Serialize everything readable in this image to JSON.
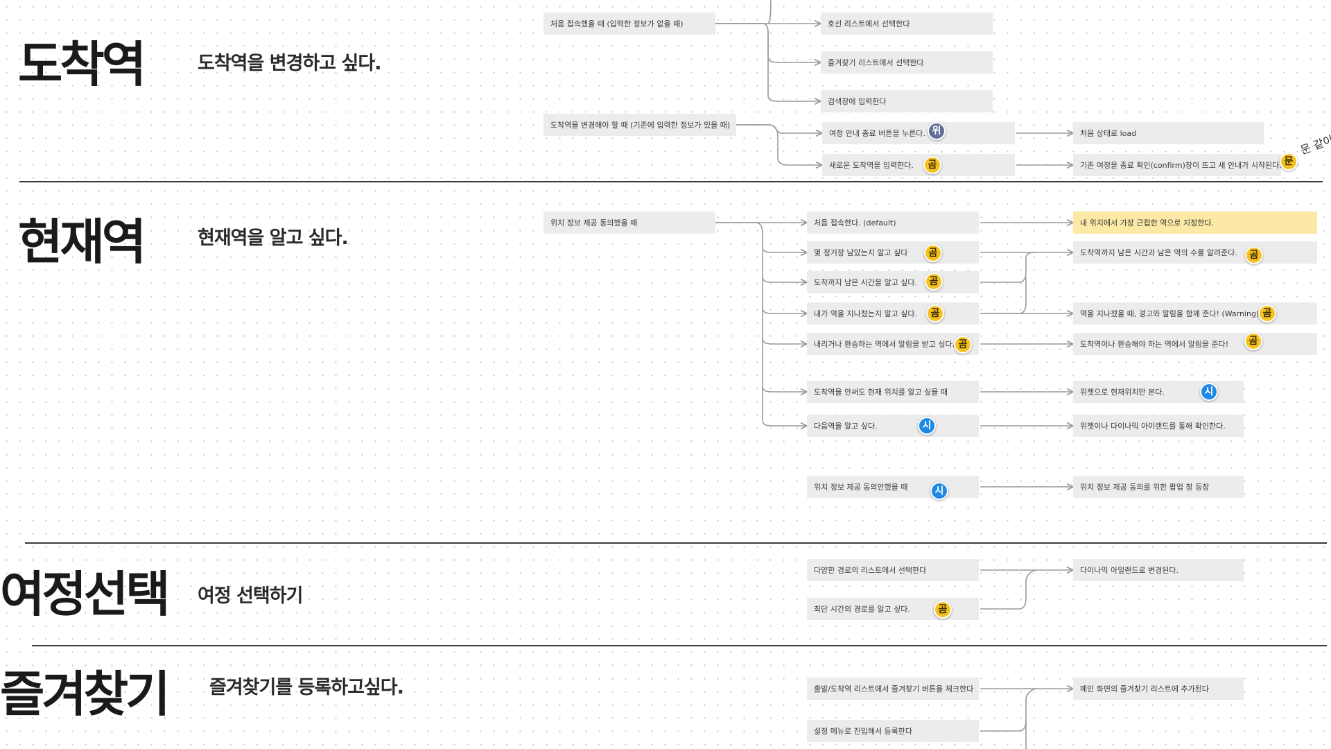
{
  "colors": {
    "badge_yellow": "#f6c221",
    "badge_blue": "#1e88e5",
    "badge_slate": "#5f6f94",
    "node_bg": "#ececec",
    "node_highlight": "#fbe9a5",
    "connector": "#9a9a9a",
    "divider": "#3a3a3a"
  },
  "sections": {
    "arrival": {
      "title": "도착역",
      "subtitle": "도착역을 변경하고 싶다.",
      "nodes": {
        "first_access": "처음 접속했을 때 (입력한 정보가 없을 때)",
        "line_list": "호선 리스트에서 선택한다",
        "favorites_list": "즐겨찾기 리스트에서 선택한다",
        "search_input": "검색창에 입력한다",
        "change_needed": "도착역을 변경해야 할 때 (기존에 입력한 정보가 있을 때)",
        "end_guide_button": "여정 안내 종료 버튼을 누른다.",
        "new_station_input": "새로운 도착역을 입력한다.",
        "initial_load": "처음 상태로 load",
        "confirm_new_guide": "기존 여정을 종료 확인(confirm)창이 뜨고 새 안내가 시작된다."
      },
      "badges": {
        "end_guide": "위",
        "new_station": "곰",
        "confirm": "문"
      },
      "edge_note": "문 같이"
    },
    "current": {
      "title": "현재역",
      "subtitle": "현재역을 알고 싶다.",
      "nodes": {
        "location_agreed": "위치 정보 제공 동의했을 때",
        "first_default": "처음 접속한다. (default)",
        "stops_left": "몇 정거장 남았는지 알고 싶다",
        "time_left": "도착까지 남은 시간을 알고 싶다.",
        "passed_station": "내가 역을 지나쳤는지 알고 싶다.",
        "transfer_alert": "내리거나 환승하는 역에서 알림을 받고 싶다.",
        "location_without_arrival": "도착역을 안써도 현재 위치를 알고 싶을 때",
        "next_station": "다음역을 알고 싶다.",
        "location_not_agreed": "위치 정보 제공 동의안했을 때",
        "nearest_station": "내 위치에서 가장 근접한 역으로 지정한다.",
        "time_and_count": "도착역까지 남은 시간과 남은 역의 수를 알려준다.",
        "passed_warning": "역을 지나쳤을 때, 경고와 알림을 함께 준다! (Warning)",
        "station_alert": "도착역이나 환승해야 하는 역에서 알림을 준다!",
        "widget_location": "위젯으로 현재위치만 본다.",
        "widget_dynamic": "위젯이나 다이나믹 아이랜드를 통해 확인한다.",
        "consent_popup": "위치 정보 제공 동의를 위한 팝업 창 등장"
      },
      "badges": {
        "stops_left": "곰",
        "time_left": "곰",
        "passed_station": "곰",
        "transfer_alert": "곰",
        "next_station": "시",
        "location_not_agreed": "시",
        "time_and_count": "곰",
        "passed_warning": "곰",
        "station_alert": "곰",
        "widget_location": "시"
      }
    },
    "journey": {
      "title": "여정선택",
      "subtitle": "여정 선택하기",
      "nodes": {
        "route_list": "다양한 경로의 리스트에서 선택한다",
        "shortest_route": "최단 시간의 경로를 알고 싶다.",
        "dynamic_island": "다이나믹 아일랜드로 변경된다."
      },
      "badges": {
        "shortest_route": "곰"
      }
    },
    "favorites": {
      "title": "즐겨찾기",
      "subtitle": "즐겨찾기를 등록하고싶다.",
      "nodes": {
        "check_favorite": "출발/도착역 리스트에서 즐겨찾기 버튼을 체크한다",
        "settings_menu": "설정 메뉴로 진입해서 등록한다",
        "add_to_main": "메인 화면의 즐겨찾기 리스트에 추가된다"
      }
    }
  }
}
